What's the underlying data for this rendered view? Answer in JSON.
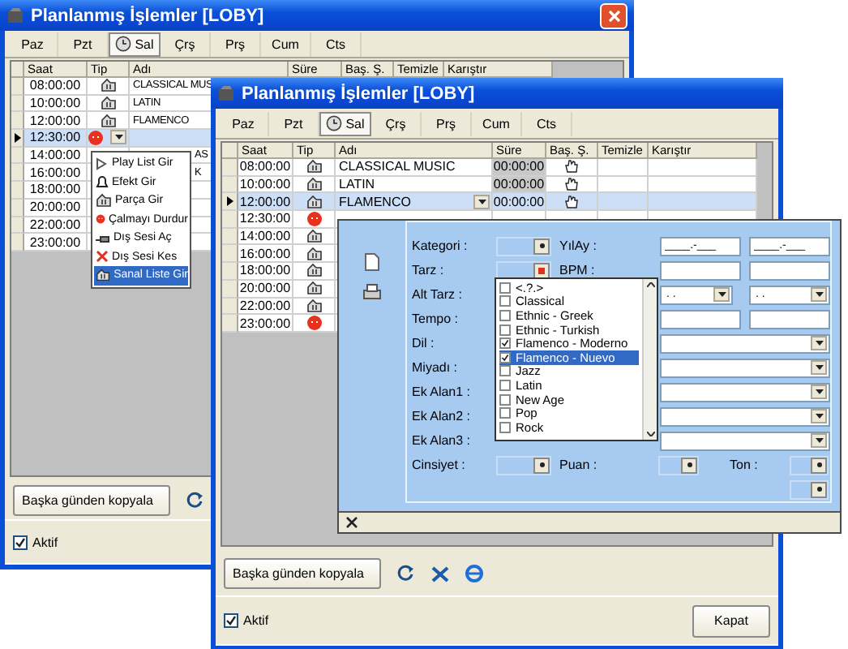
{
  "back_window": {
    "title": "Planlanmış İşlemler [LOBY]",
    "tabs": [
      {
        "label": "Paz",
        "selected": false
      },
      {
        "label": "Pzt",
        "selected": false
      },
      {
        "label": "Sal",
        "selected": true
      },
      {
        "label": "Çrş",
        "selected": false
      },
      {
        "label": "Prş",
        "selected": false
      },
      {
        "label": "Cum",
        "selected": false
      },
      {
        "label": "Cts",
        "selected": false
      }
    ],
    "columns": [
      "Saat",
      "Tip",
      "Adı",
      "Süre",
      "Baş. Ş.",
      "Temizle",
      "Karıştır"
    ],
    "rows": [
      {
        "time": "08:00:00",
        "kind": "playlist",
        "name": "CLASSICAL MUS",
        "selected": false
      },
      {
        "time": "10:00:00",
        "kind": "playlist",
        "name": "LATIN",
        "selected": false
      },
      {
        "time": "12:00:00",
        "kind": "playlist",
        "name": "FLAMENCO",
        "selected": false
      },
      {
        "time": "12:30:00",
        "kind": "stop",
        "selected": true
      },
      {
        "time": "14:00:00",
        "name": "AS",
        "partly_covered": true,
        "selected": false
      },
      {
        "time": "16:00:00",
        "name": "K",
        "partly_covered": true,
        "selected": false
      },
      {
        "time": "18:00:00",
        "selected": false
      },
      {
        "time": "20:00:00",
        "selected": false
      },
      {
        "time": "22:00:00",
        "selected": false
      },
      {
        "time": "23:00:00",
        "selected": false
      }
    ],
    "context_menu": [
      {
        "label": "Play List Gir",
        "selected": false
      },
      {
        "label": "Efekt Gir",
        "selected": false
      },
      {
        "label": "Parça Gir",
        "selected": false
      },
      {
        "label": "Çalmayı Durdur",
        "selected": false
      },
      {
        "label": "Dış Sesi Aç",
        "selected": false
      },
      {
        "label": "Dış Sesi Kes",
        "selected": false
      },
      {
        "label": "Sanal Liste Gir",
        "selected": true
      }
    ],
    "copy_button": "Başka günden kopyala",
    "aktif": {
      "label": "Aktif",
      "checked": true
    }
  },
  "front_window": {
    "title": "Planlanmış İşlemler [LOBY]",
    "tabs": [
      {
        "label": "Paz",
        "selected": false
      },
      {
        "label": "Pzt",
        "selected": false
      },
      {
        "label": "Sal",
        "selected": true
      },
      {
        "label": "Çrş",
        "selected": false
      },
      {
        "label": "Prş",
        "selected": false
      },
      {
        "label": "Cum",
        "selected": false
      },
      {
        "label": "Cts",
        "selected": false
      }
    ],
    "columns": [
      "Saat",
      "Tip",
      "Adı",
      "Süre",
      "Baş. Ş.",
      "Temizle",
      "Karıştır"
    ],
    "rows": [
      {
        "time": "08:00:00",
        "kind": "playlist",
        "name": "CLASSICAL MUSIC",
        "duration": "00:00:00",
        "hand": true,
        "selected": false
      },
      {
        "time": "10:00:00",
        "kind": "playlist",
        "name": "LATIN",
        "duration": "00:00:00",
        "hand": true,
        "selected": false
      },
      {
        "time": "12:00:00",
        "kind": "playlist",
        "name": "FLAMENCO",
        "duration": "00:00:00",
        "hand": true,
        "selected": true
      },
      {
        "time": "12:30:00",
        "kind": "stop",
        "selected": false
      },
      {
        "time": "14:00:00",
        "kind": "playlist",
        "selected": false
      },
      {
        "time": "16:00:00",
        "kind": "playlist",
        "selected": false
      },
      {
        "time": "18:00:00",
        "kind": "playlist",
        "selected": false
      },
      {
        "time": "20:00:00",
        "kind": "playlist",
        "selected": false
      },
      {
        "time": "22:00:00",
        "kind": "playlist",
        "selected": false
      },
      {
        "time": "23:00:00",
        "kind": "stop",
        "selected": false
      }
    ],
    "edit_panel": {
      "form_rows": [
        {
          "kind": "lookup_text",
          "label": "Kategori :",
          "open": false,
          "label2": "YılAy :",
          "values": [
            "____.-___",
            "____.-___"
          ]
        },
        {
          "kind": "lookup_text",
          "label": "Tarz :",
          "open": true,
          "label2": "BPM :"
        },
        {
          "kind": "combo_pair",
          "label": "Alt Tarz :",
          "values": [
            ". .",
            ". ."
          ]
        },
        {
          "kind": "text_pair",
          "label": "Tempo :"
        },
        {
          "kind": "wide_combo",
          "label": "Dil :"
        },
        {
          "kind": "wide_combo",
          "label": "Miyadı :"
        },
        {
          "kind": "wide_combo",
          "label": "Ek Alan1 :"
        },
        {
          "kind": "wide_combo",
          "label": "Ek Alan2 :"
        },
        {
          "kind": "wide_combo",
          "label": "Ek Alan3 :"
        },
        {
          "kind": "rating",
          "label": "Cinsiyet :",
          "label2": "Puan :",
          "label3": "Ton :"
        }
      ],
      "style_list": [
        {
          "label": "<.?.>",
          "checked": false,
          "selected": false
        },
        {
          "label": "Classical",
          "checked": false,
          "selected": false
        },
        {
          "label": "Ethnic - Greek",
          "checked": false,
          "selected": false
        },
        {
          "label": "Ethnic - Turkish",
          "checked": false,
          "selected": false
        },
        {
          "label": "Flamenco - Moderno",
          "checked": true,
          "selected": false
        },
        {
          "label": "Flamenco - Nuevo",
          "checked": true,
          "selected": true
        },
        {
          "label": "Jazz",
          "checked": false,
          "selected": false
        },
        {
          "label": "Latin",
          "checked": false,
          "selected": false
        },
        {
          "label": "New Age",
          "checked": false,
          "selected": false
        },
        {
          "label": "Pop",
          "checked": false,
          "selected": false
        },
        {
          "label": "Rock",
          "checked": false,
          "selected": false
        }
      ]
    },
    "copy_button": "Başka günden kopyala",
    "aktif": {
      "label": "Aktif",
      "checked": true
    },
    "close_button": "Kapat"
  }
}
